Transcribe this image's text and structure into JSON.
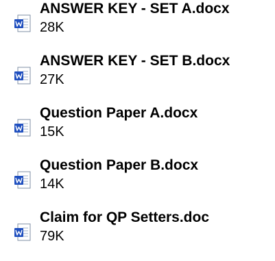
{
  "files": [
    {
      "name": "ANSWER KEY - SET A.docx",
      "size": "28K",
      "icon": "word-document-icon"
    },
    {
      "name": "ANSWER KEY - SET B.docx",
      "size": "27K",
      "icon": "word-document-icon"
    },
    {
      "name": "Question Paper A.docx",
      "size": "15K",
      "icon": "word-document-icon"
    },
    {
      "name": "Question Paper B.docx",
      "size": "14K",
      "icon": "word-document-icon"
    },
    {
      "name": "Claim for QP Setters.doc",
      "size": "79K",
      "icon": "word-document-icon"
    }
  ],
  "colors": {
    "icon_blue": "#1f4fbf",
    "icon_page": "#ffffff",
    "icon_border": "#7f8fa6"
  }
}
